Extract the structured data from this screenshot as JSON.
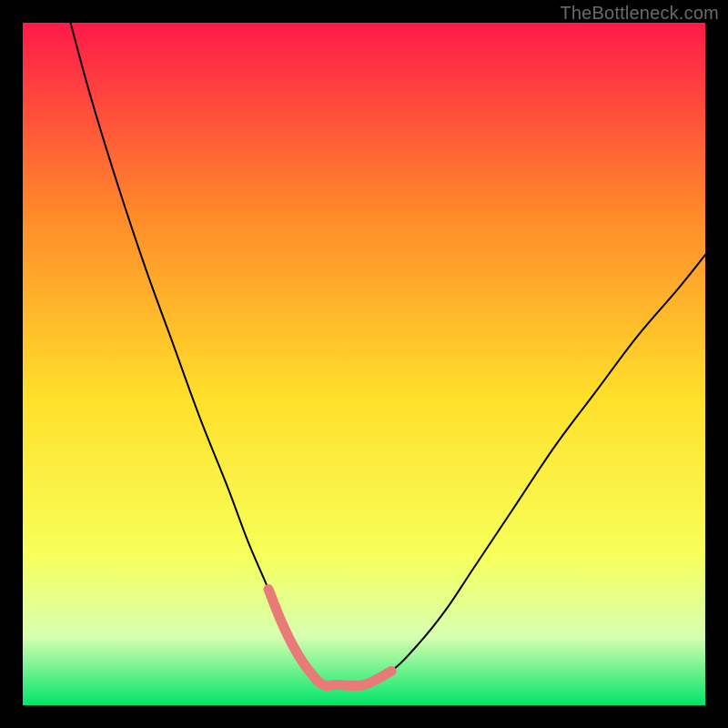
{
  "watermark": "TheBottleneck.com",
  "chart_data": {
    "type": "line",
    "title": "",
    "xlabel": "",
    "ylabel": "",
    "xlim": [
      0,
      100
    ],
    "ylim": [
      0,
      100
    ],
    "background_gradient": {
      "top": "#ff1a4a",
      "mid_upper": "#ff8a2a",
      "mid": "#ffe02a",
      "mid_lower": "#f7ff5a",
      "lower": "#d6ffb0",
      "bottom": "#00e56a"
    },
    "series": [
      {
        "name": "bottleneck-curve",
        "color": "#000000",
        "stroke_width": 2,
        "x": [
          7,
          10,
          14,
          18,
          22,
          26,
          30,
          33,
          36,
          38,
          40,
          42,
          44,
          46,
          50,
          54,
          58,
          62,
          66,
          72,
          78,
          84,
          90,
          96,
          100
        ],
        "values": [
          100,
          89,
          76,
          64,
          53,
          42,
          32,
          24,
          17,
          12,
          8,
          5,
          3,
          3,
          3,
          5,
          9,
          14,
          20,
          29,
          38,
          46,
          54,
          61,
          66
        ]
      },
      {
        "name": "highlight-valley",
        "color": "#e87a78",
        "stroke_width": 11,
        "x": [
          36,
          38,
          40,
          42,
          44,
          46,
          50,
          54
        ],
        "values": [
          17,
          12,
          8,
          5,
          3,
          3,
          3,
          5
        ]
      }
    ],
    "annotations": []
  }
}
